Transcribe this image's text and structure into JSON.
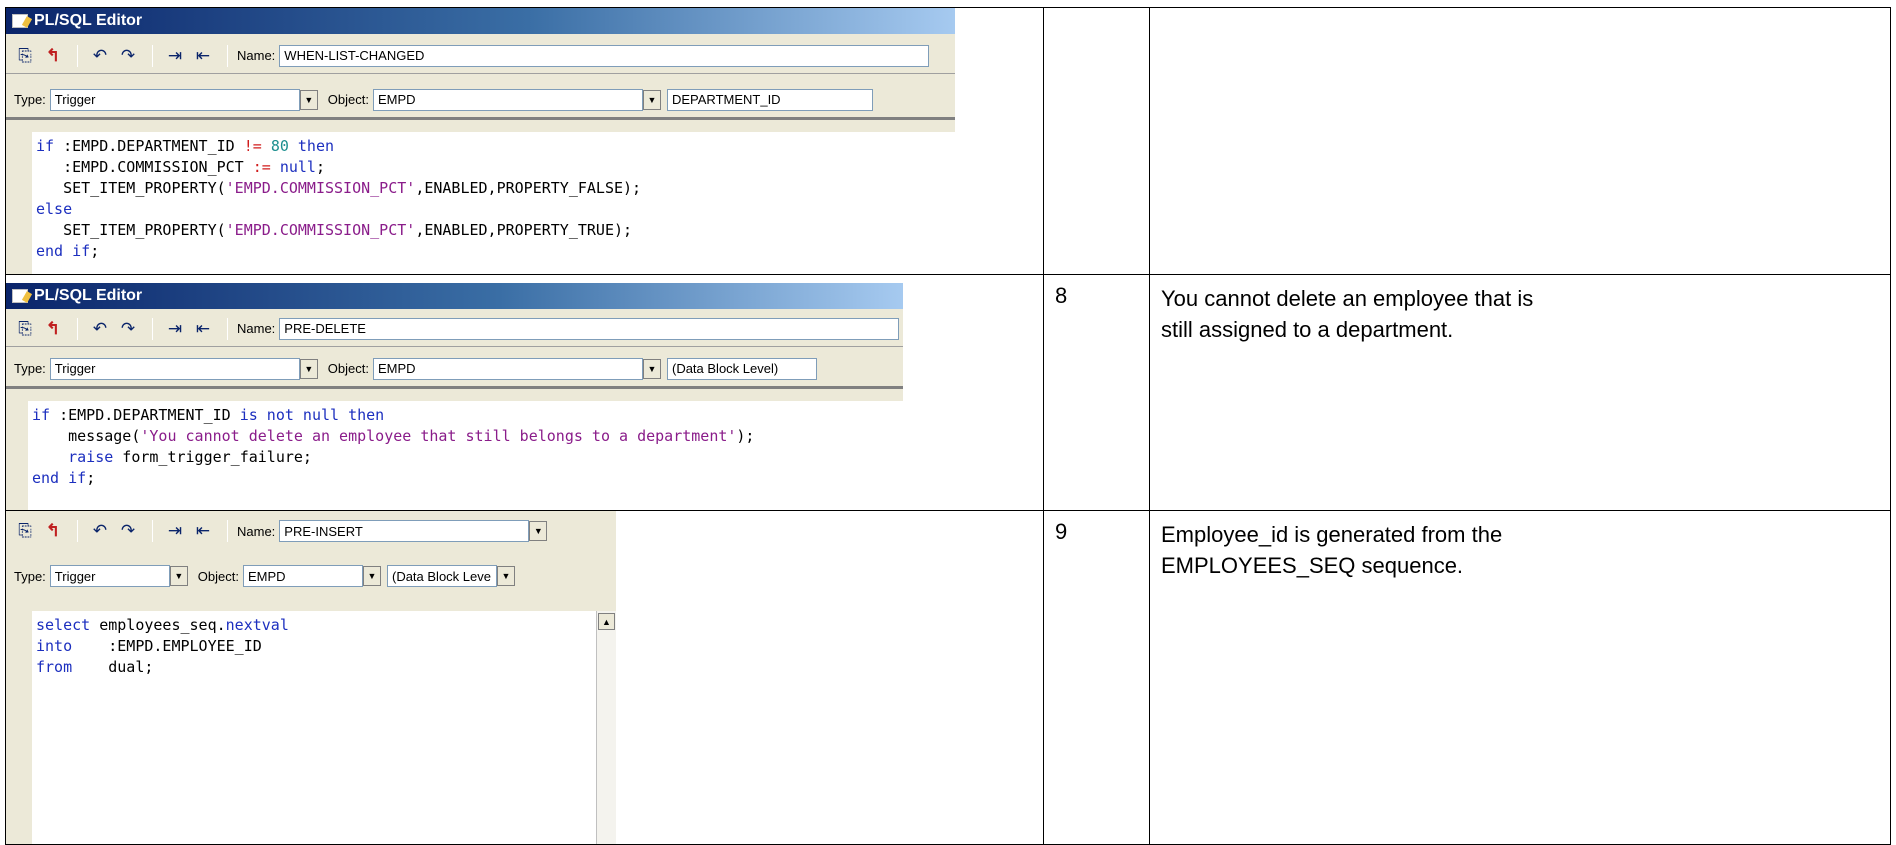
{
  "rows": [
    {
      "number": "",
      "description": "",
      "editor": {
        "title": "PL/SQL Editor",
        "name_label": "Name:",
        "name_value": "WHEN-LIST-CHANGED",
        "type_label": "Type:",
        "type_value": "Trigger",
        "object_label": "Object:",
        "object_value": "EMPD",
        "level_value": "DEPARTMENT_ID"
      }
    },
    {
      "number": "8",
      "description": "You cannot delete an employee that is still assigned to a department.",
      "editor": {
        "title": "PL/SQL Editor",
        "name_label": "Name:",
        "name_value": "PRE-DELETE",
        "type_label": "Type:",
        "type_value": "Trigger",
        "object_label": "Object:",
        "object_value": "EMPD",
        "level_value": "(Data Block Level)"
      }
    },
    {
      "number": "9",
      "description": "Employee_id is generated from the EMPLOYEES_SEQ sequence.",
      "editor": {
        "name_label": "Name:",
        "name_value": "PRE-INSERT",
        "type_label": "Type:",
        "type_value": "Trigger",
        "object_label": "Object:",
        "object_value": "EMPD",
        "level_value": "(Data Block Leve"
      }
    }
  ],
  "code": {
    "when_list_changed": [
      [
        [
          "kw",
          "if"
        ],
        [
          "t",
          " :EMPD.DEPARTMENT_ID "
        ],
        [
          "op",
          "!="
        ],
        [
          "t",
          " "
        ],
        [
          "num",
          "80"
        ],
        [
          "t",
          " "
        ],
        [
          "kw",
          "then"
        ]
      ],
      [
        [
          "t",
          "   :EMPD.COMMISSION_PCT "
        ],
        [
          "op",
          ":="
        ],
        [
          "t",
          " "
        ],
        [
          "kw",
          "null"
        ],
        [
          "t",
          ";"
        ]
      ],
      [
        [
          "t",
          "   SET_ITEM_PROPERTY("
        ],
        [
          "str",
          "'EMPD.COMMISSION_PCT'"
        ],
        [
          "t",
          ",ENABLED,PROPERTY_FALSE);"
        ]
      ],
      [
        [
          "kw",
          "else"
        ]
      ],
      [
        [
          "t",
          "   SET_ITEM_PROPERTY("
        ],
        [
          "str",
          "'EMPD.COMMISSION_PCT'"
        ],
        [
          "t",
          ",ENABLED,PROPERTY_TRUE);"
        ]
      ],
      [
        [
          "kw",
          "end if"
        ],
        [
          "t",
          ";"
        ]
      ]
    ],
    "pre_delete": [
      [
        [
          "kw",
          "if"
        ],
        [
          "t",
          " :EMPD.DEPARTMENT_ID "
        ],
        [
          "kw",
          "is not null then"
        ]
      ],
      [
        [
          "t",
          "    message("
        ],
        [
          "str",
          "'You cannot delete an employee that still belongs to a department'"
        ],
        [
          "t",
          ");"
        ]
      ],
      [
        [
          "t",
          "    "
        ],
        [
          "kw",
          "raise"
        ],
        [
          "t",
          " form_trigger_failure;"
        ]
      ],
      [
        [
          "kw",
          "end if"
        ],
        [
          "t",
          ";"
        ]
      ]
    ],
    "pre_insert": [
      [
        [
          "kw",
          "select"
        ],
        [
          "t",
          " employees_seq."
        ],
        [
          "kw",
          "nextval"
        ]
      ],
      [
        [
          "kw",
          "into"
        ],
        [
          "t",
          "    :EMPD.EMPLOYEE_ID"
        ]
      ],
      [
        [
          "kw",
          "from"
        ],
        [
          "t",
          "    dual;"
        ]
      ]
    ]
  },
  "colors": {
    "titlebar_start": "#0a246a",
    "titlebar_end": "#a6caf0",
    "keyword": "#1c2fbf",
    "string": "#8a1c8a",
    "number": "#1c8f8f",
    "operator": "#d01c1c"
  }
}
